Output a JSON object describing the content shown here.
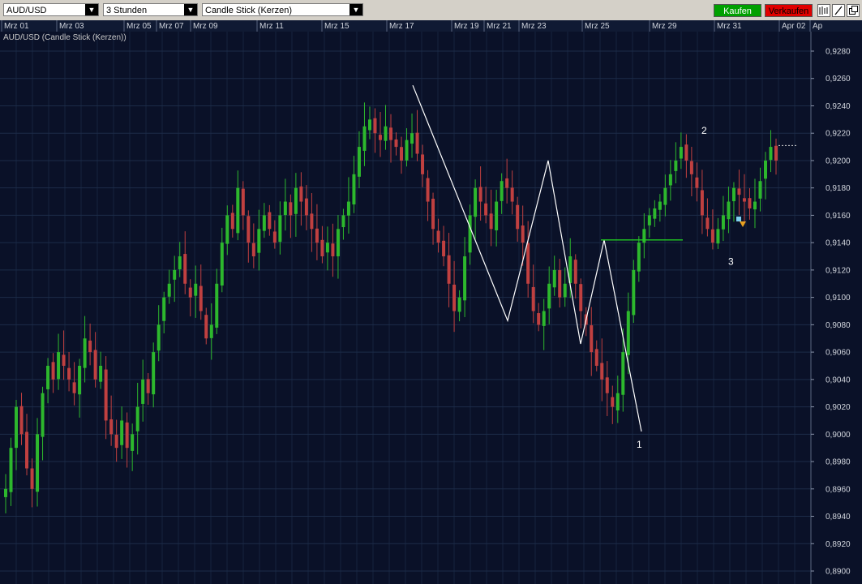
{
  "toolbar": {
    "symbol": "AUD/USD",
    "interval": "3 Stunden",
    "chart_type": "Candle Stick (Kerzen)",
    "buy_label": "Kaufen",
    "sell_label": "Verkaufen",
    "buy_color": "#00a000",
    "sell_color": "#e00000",
    "icons": [
      "bar-chart-icon",
      "draw-line-icon",
      "window-icon"
    ]
  },
  "chart_data": {
    "type": "candlestick",
    "title": "AUD/USD (Candle Stick (Kerzen))",
    "date_ticks": [
      "Mrz 01",
      "Mrz 03",
      "Mrz 05",
      "Mrz 07",
      "Mrz 09",
      "Mrz 11",
      "Mrz 15",
      "Mrz 17",
      "Mrz 19",
      "Mrz 21",
      "Mrz 23",
      "Mrz 25",
      "Mrz 29",
      "Mrz 31",
      "Apr 02",
      "Ap"
    ],
    "y_ticks": [
      "0,9280",
      "0,9260",
      "0,9240",
      "0,9220",
      "0,9200",
      "0,9180",
      "0,9160",
      "0,9140",
      "0,9120",
      "0,9100",
      "0,9080",
      "0,9060",
      "0,9040",
      "0,9020",
      "0,9000",
      "0,8980",
      "0,8960",
      "0,8940",
      "0,8920",
      "0,8900"
    ],
    "ylim": [
      0.89,
      0.928
    ],
    "grid": true,
    "colors": {
      "background": "#0a1128",
      "grid": "#1c2c48",
      "up": "#2db82d",
      "down": "#c04040",
      "pattern": "#ffffff",
      "neckline": "#22cc22"
    },
    "price_path": [
      0.896,
      0.899,
      0.902,
      0.9,
      0.8975,
      0.896,
      0.9,
      0.903,
      0.905,
      0.904,
      0.906,
      0.905,
      0.904,
      0.903,
      0.905,
      0.907,
      0.906,
      0.904,
      0.905,
      0.901,
      0.9,
      0.899,
      0.901,
      0.899,
      0.9,
      0.902,
      0.904,
      0.903,
      0.906,
      0.908,
      0.91,
      0.911,
      0.912,
      0.913,
      0.911,
      0.91,
      0.911,
      0.909,
      0.907,
      0.908,
      0.911,
      0.914,
      0.916,
      0.915,
      0.918,
      0.916,
      0.914,
      0.913,
      0.915,
      0.916,
      0.915,
      0.914,
      0.916,
      0.917,
      0.916,
      0.918,
      0.917,
      0.916,
      0.915,
      0.914,
      0.913,
      0.914,
      0.913,
      0.915,
      0.916,
      0.917,
      0.919,
      0.921,
      0.9225,
      0.923,
      0.922,
      0.9215,
      0.9225,
      0.9215,
      0.921,
      0.92,
      0.9215,
      0.922,
      0.9205,
      0.919,
      0.917,
      0.915,
      0.914,
      0.913,
      0.911,
      0.909,
      0.91,
      0.913,
      0.916,
      0.918,
      0.917,
      0.916,
      0.915,
      0.917,
      0.9185,
      0.918,
      0.917,
      0.915,
      0.914,
      0.911,
      0.909,
      0.908,
      0.909,
      0.911,
      0.912,
      0.91,
      0.911,
      0.913,
      0.911,
      0.909,
      0.908,
      0.906,
      0.905,
      0.904,
      0.903,
      0.902,
      0.903,
      0.906,
      0.909,
      0.912,
      0.914,
      0.915,
      0.916,
      0.9165,
      0.917,
      0.918,
      0.919,
      0.92,
      0.921,
      0.92,
      0.919,
      0.918,
      0.916,
      0.915,
      0.914,
      0.915,
      0.916,
      0.917,
      0.918,
      0.9175,
      0.917,
      0.9165,
      0.917,
      0.9185,
      0.92,
      0.921,
      0.92
    ],
    "zigzag": [
      {
        "label": "",
        "price": 0.9255
      },
      {
        "label": "",
        "price": 0.9083
      },
      {
        "label": "",
        "price": 0.92
      },
      {
        "label": "",
        "price": 0.9066
      },
      {
        "label": "",
        "price": 0.9142
      },
      {
        "label": "1",
        "price": 0.9002
      }
    ],
    "neckline": 0.9142,
    "last_price": 0.9211,
    "annotations": [
      {
        "label": "2",
        "price": 0.9216
      },
      {
        "label": "3",
        "price": 0.9135
      }
    ]
  }
}
